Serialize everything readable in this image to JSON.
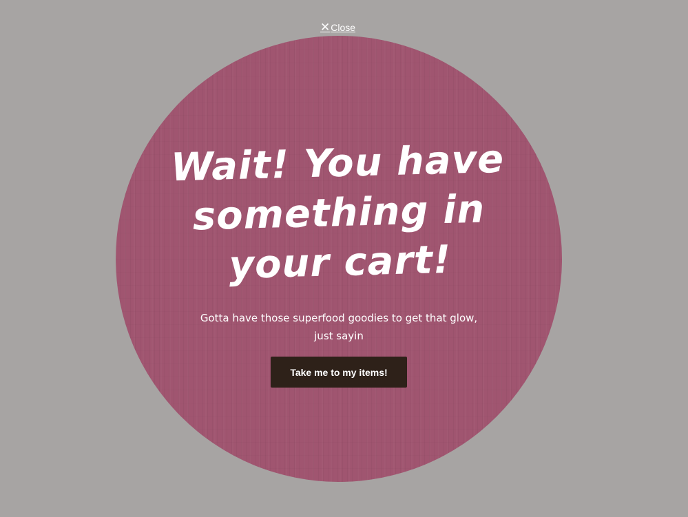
{
  "close": {
    "icon": "close-x-icon",
    "label": "Close"
  },
  "popup": {
    "headline_lines": [
      "Wait! You have",
      "something in",
      "your cart!"
    ],
    "subtitle": "Gotta have those superfood goodies to get that glow, just sayin",
    "cta_label": "Take me to my items!"
  },
  "colors": {
    "overlay": "#a7a4a3",
    "circle": "#a05570",
    "button": "#2e2119",
    "text": "#ffffff"
  }
}
